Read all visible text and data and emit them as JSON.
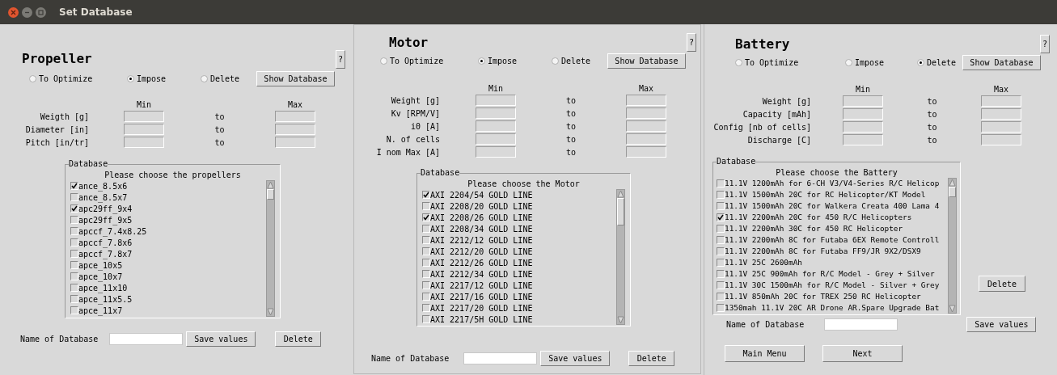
{
  "window": {
    "title": "Set Database"
  },
  "panels": [
    {
      "title": "Propeller",
      "help_button": "?",
      "modes": [
        {
          "label": "To Optimize",
          "selected": false
        },
        {
          "label": "Impose",
          "selected": true
        },
        {
          "label": "Delete",
          "selected": false
        }
      ],
      "show_database_button": "Show Database",
      "min_header": "Min",
      "max_header": "Max",
      "parameters": [
        {
          "label": "Weigth [g]",
          "separator": "to"
        },
        {
          "label": "Diameter [in]",
          "separator": "to"
        },
        {
          "label": "Pitch [in/tr]",
          "separator": "to"
        }
      ],
      "database": {
        "legend": "Database",
        "prompt": "Please choose the propellers",
        "items": [
          {
            "label": "ance_8.5x6",
            "checked": true
          },
          {
            "label": "ance_8.5x7",
            "checked": false
          },
          {
            "label": "apc29ff_9x4",
            "checked": true
          },
          {
            "label": "apc29ff_9x5",
            "checked": false
          },
          {
            "label": "apccf_7.4x8.25",
            "checked": false
          },
          {
            "label": "apccf_7.8x6",
            "checked": false
          },
          {
            "label": "apccf_7.8x7",
            "checked": false
          },
          {
            "label": "apce_10x5",
            "checked": false
          },
          {
            "label": "apce_10x7",
            "checked": false
          },
          {
            "label": "apce_11x10",
            "checked": false
          },
          {
            "label": "apce_11x5.5",
            "checked": false
          },
          {
            "label": "apce_11x7",
            "checked": false
          }
        ]
      },
      "name_label": "Name of Database",
      "save_button": "Save values",
      "delete_button": "Delete"
    },
    {
      "title": "Motor",
      "help_button": "?",
      "modes": [
        {
          "label": "To Optimize",
          "selected": false
        },
        {
          "label": "Impose",
          "selected": true
        },
        {
          "label": "Delete",
          "selected": false
        }
      ],
      "show_database_button": "Show Database",
      "min_header": "Min",
      "max_header": "Max",
      "parameters": [
        {
          "label": "Weight [g]",
          "separator": "to"
        },
        {
          "label": "Kv [RPM/V]",
          "separator": "to"
        },
        {
          "label": "i0 [A]",
          "separator": "to"
        },
        {
          "label": "N. of cells",
          "separator": "to"
        },
        {
          "label": "I nom Max [A]",
          "separator": "to"
        }
      ],
      "database": {
        "legend": "Database",
        "prompt": "Please choose the Motor",
        "items": [
          {
            "label": "AXI 2204/54 GOLD LINE",
            "checked": true
          },
          {
            "label": "AXI 2208/20 GOLD LINE",
            "checked": false
          },
          {
            "label": "AXI 2208/26 GOLD LINE",
            "checked": true
          },
          {
            "label": "AXI 2208/34 GOLD LINE",
            "checked": false
          },
          {
            "label": "AXI 2212/12 GOLD LINE",
            "checked": false
          },
          {
            "label": "AXI 2212/20 GOLD LINE",
            "checked": false
          },
          {
            "label": "AXI 2212/26 GOLD LINE",
            "checked": false
          },
          {
            "label": "AXI 2212/34 GOLD LINE",
            "checked": false
          },
          {
            "label": "AXI 2217/12 GOLD LINE",
            "checked": false
          },
          {
            "label": "AXI 2217/16 GOLD LINE",
            "checked": false
          },
          {
            "label": "AXI 2217/20 GOLD LINE",
            "checked": false
          },
          {
            "label": "AXI 2217/5H GOLD LINE",
            "checked": false
          }
        ]
      },
      "name_label": "Name of Database",
      "save_button": "Save values",
      "delete_button": "Delete"
    },
    {
      "title": "Battery",
      "help_button": "?",
      "modes": [
        {
          "label": "To Optimize",
          "selected": false
        },
        {
          "label": "Impose",
          "selected": false
        },
        {
          "label": "Delete",
          "selected": true
        }
      ],
      "show_database_button": "Show Database",
      "min_header": "Min",
      "max_header": "Max",
      "parameters": [
        {
          "label": "Weight [g]",
          "separator": "to"
        },
        {
          "label": "Capacity [mAh]",
          "separator": "to"
        },
        {
          "label": "Config [nb of cells]",
          "separator": "to"
        },
        {
          "label": "Discharge [C]",
          "separator": "to"
        }
      ],
      "database": {
        "legend": "Database",
        "prompt": "Please choose the Battery",
        "items": [
          {
            "label": "11.1V 1200mAh for 6-CH V3/V4-Series R/C Helicop",
            "checked": false
          },
          {
            "label": "11.1V 1500mAh 20C for RC Helicopter/KT Model",
            "checked": false
          },
          {
            "label": "11.1V 1500mAh 20C for Walkera Creata 400 Lama 4",
            "checked": false
          },
          {
            "label": "11.1V 2200mAh 20C for 450 R/C Helicopters",
            "checked": true
          },
          {
            "label": "11.1V 2200mAh 30C for 450 RC Helicopter",
            "checked": false
          },
          {
            "label": "11.1V 2200mAh 8C for Futaba 6EX Remote Controll",
            "checked": false
          },
          {
            "label": "11.1V 2200mAh 8C for Futaba FF9/JR 9X2/DSX9",
            "checked": false
          },
          {
            "label": "11.1V 25C 2600mAh",
            "checked": false
          },
          {
            "label": "11.1V 25C 900mAh for R/C Model - Grey + Silver",
            "checked": false
          },
          {
            "label": "11.1V 30C 1500mAh for R/C Model - Silver + Grey",
            "checked": false
          },
          {
            "label": "11.1V 850mAh 20C for TREX 250 RC Helicopter",
            "checked": false
          },
          {
            "label": "1350mah 11.1V 20C AR Drone AR.Spare Upgrade Bat",
            "checked": false
          }
        ]
      },
      "name_label": "Name of Database",
      "save_button": "Save values",
      "delete_button": "Delete"
    }
  ],
  "navigation": [
    {
      "label": "Main Menu"
    },
    {
      "label": "Next"
    }
  ]
}
